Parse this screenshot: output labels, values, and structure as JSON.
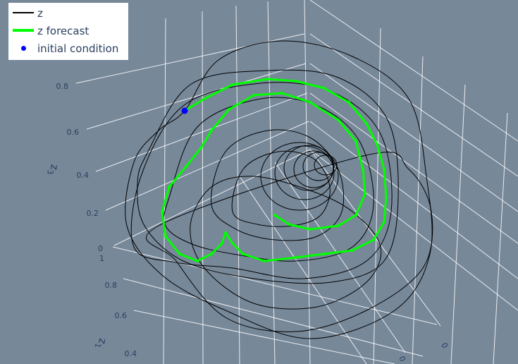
{
  "chart_data": {
    "type": "line3d",
    "title": "",
    "axes": {
      "z3": {
        "title": "z",
        "title_sub": "3",
        "ticks": [
          "0",
          "0.2",
          "0.4",
          "0.6",
          "0.8"
        ]
      },
      "z1": {
        "title": "z",
        "title_sub": "1",
        "ticks": [
          "1",
          "0.8",
          "0.6",
          "0.4"
        ]
      },
      "z2": {
        "ticks": [
          "0",
          "0"
        ]
      }
    },
    "grid": true,
    "legend_position": "top-left",
    "series": [
      {
        "name": "z",
        "color": "#000000",
        "style": "line"
      },
      {
        "name": "z forecast",
        "color": "#00ff00",
        "style": "line-markers"
      },
      {
        "name": "initial condition",
        "color": "#0000ff",
        "style": "marker"
      }
    ]
  },
  "colors": {
    "background": "#778899",
    "grid": "#ffffff",
    "trajectory": "#000000",
    "forecast": "#00ff00",
    "initial_condition": "#0000ff",
    "legend_bg": "#ffffff"
  }
}
